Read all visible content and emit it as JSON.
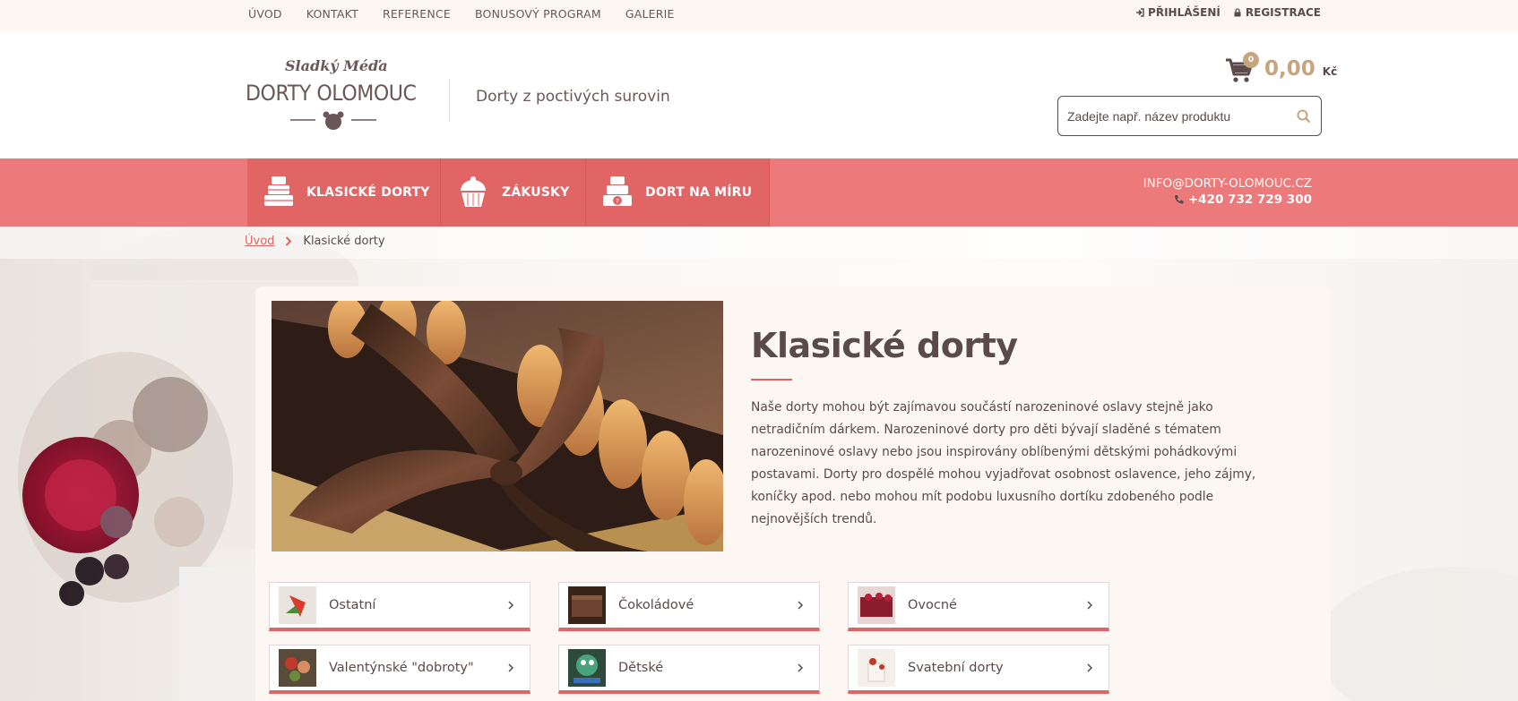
{
  "topnav": [
    "ÚVOD",
    "KONTAKT",
    "REFERENCE",
    "BONUSOVÝ PROGRAM",
    "GALERIE"
  ],
  "user": {
    "login": "PŘIHLÁŠENÍ",
    "register": "REGISTRACE"
  },
  "logo": {
    "sub": "Sladký Méďa",
    "main": "DORTY OLOMOUC"
  },
  "tagline": "Dorty z poctivých surovin",
  "cart": {
    "count": "0",
    "total": "0,00",
    "currency": "Kč"
  },
  "search": {
    "placeholder": "Zadejte např. název produktu"
  },
  "mainnav": [
    "KLASICKÉ DORTY",
    "ZÁKUSKY",
    "DORT NA MÍRU"
  ],
  "contact": {
    "email": "INFO@DORTY-OLOMOUC.CZ",
    "phone": "+420 732 729 300"
  },
  "breadcrumb": {
    "home": "Úvod",
    "current": "Klasické dorty"
  },
  "content": {
    "title": "Klasické dorty",
    "description": "Naše dorty mohou být zajímavou součástí  narozeninové oslavy stejně jako  netradičním dárkem. Narozeninové dorty pro děti bývají sladěné s tématem narozeninové oslavy nebo jsou inspirovány oblíbenými dětskými pohádkovými postavami. Dorty pro dospělé mohou vyjadřovat osobnost oslavence, jeho zájmy, koníčky apod. nebo mohou mít podobu luxusního dortíku zdobeného podle nejnovějších trendů."
  },
  "categories": [
    "Ostatní",
    "Čokoládové",
    "Ovocné",
    "Valentýnské \"dobroty\"",
    "Dětské",
    "Svatební dorty"
  ],
  "colors": {
    "accent": "#e16565",
    "nav": "#ec7a7a",
    "gold": "#c7a67e",
    "text": "#5a4a4a"
  }
}
